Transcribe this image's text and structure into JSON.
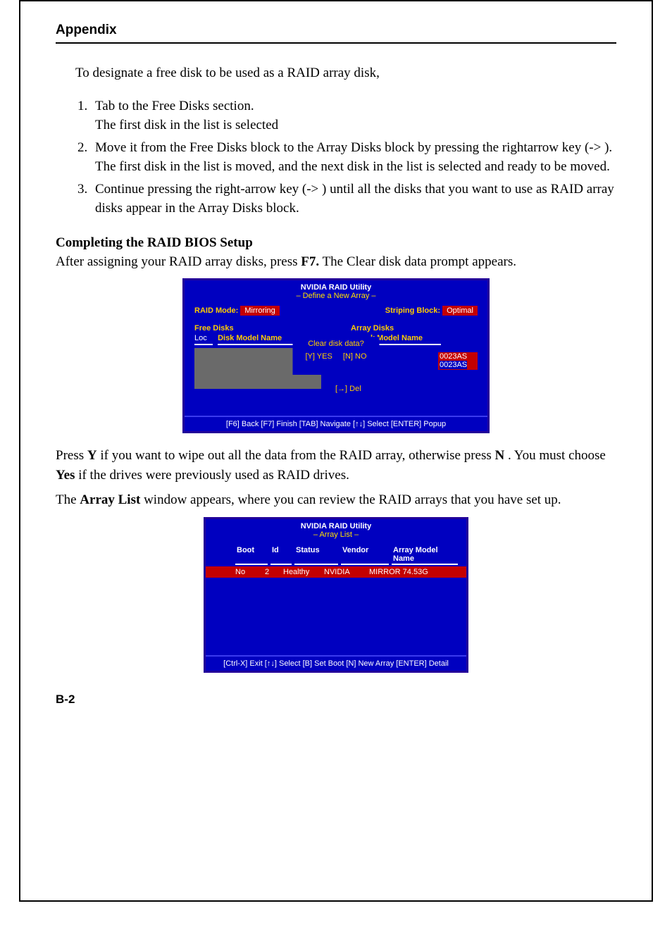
{
  "header": "Appendix",
  "intro": "To designate a free disk to be used as a RAID array disk,",
  "steps": [
    {
      "main": "Tab to the Free Disks section.",
      "sub": "The first disk in the list is selected"
    },
    {
      "main": "Move it from the Free Disks block to the Array Disks block by pressing the rightarrow key (-> ).",
      "sub": "The first disk in the list is moved, and the next disk in the list is selected and ready to be moved."
    },
    {
      "main": "Continue pressing the right-arrow key (-> ) until all the disks that you want to use as RAID array disks appear in the Array Disks block.",
      "sub": ""
    }
  ],
  "section_heading": "Completing the RAID BIOS Setup",
  "after_text_pre": "After assigning your RAID array disks, press ",
  "after_text_key": "F7.",
  "after_text_post": "  The Clear disk data prompt appears.",
  "press_y_pre": "Press ",
  "press_y_key": "Y",
  "press_y_mid": " if you want to wipe out all the data from the RAID array, otherwise press ",
  "press_n_key": "N",
  "press_y_post": ". You must choose ",
  "yes_bold": "Yes",
  "press_y_post2": " if the drives were previously used as RAID drives.",
  "array_list_pre": "The ",
  "array_list_bold": "Array List",
  "array_list_post": " window appears, where you can review the RAID arrays that you have set up.",
  "bios1": {
    "title": "NVIDIA RAID Utility",
    "subtitle": "–  Define a New Array  –",
    "raid_mode_label": "RAID Mode:",
    "raid_mode_value": "Mirroring",
    "striping_label": "Striping Block:",
    "striping_value": "Optimal",
    "free_disks": "Free Disks",
    "array_disks": "Array Disks",
    "loc": "Loc",
    "disk_model": "Disk Model Name",
    "disk_model_r": "k Model Name",
    "dialog_q": "Clear disk data?",
    "dialog_yes": "[Y] YES",
    "dialog_no": "[N] NO",
    "serial1": "0023AS",
    "serial2": "0023AS",
    "del": "[→] Del",
    "footer": "[F6] Back  [F7] Finish  [TAB] Navigate  [↑↓] Select  [ENTER] Popup"
  },
  "bios2": {
    "title": "NVIDIA RAID Utility",
    "subtitle": "–  Array  List –",
    "cols": {
      "boot": "Boot",
      "id": "Id",
      "status": "Status",
      "vendor": "Vendor",
      "array_model": "Array Model Name"
    },
    "row": {
      "boot": "No",
      "id": "2",
      "status": "Healthy",
      "vendor": "NVIDIA",
      "array_model": "MIRROR  74.53G"
    },
    "footer": "[Ctrl-X] Exit  [↑↓] Select  [B] Set Boot  [N] New Array  [ENTER] Detail"
  },
  "page_number": "B-2",
  "chart_data": {
    "type": "table",
    "columns": [
      "Boot",
      "Id",
      "Status",
      "Vendor",
      "Array Model Name"
    ],
    "rows": [
      [
        "No",
        "2",
        "Healthy",
        "NVIDIA",
        "MIRROR 74.53G"
      ]
    ]
  }
}
